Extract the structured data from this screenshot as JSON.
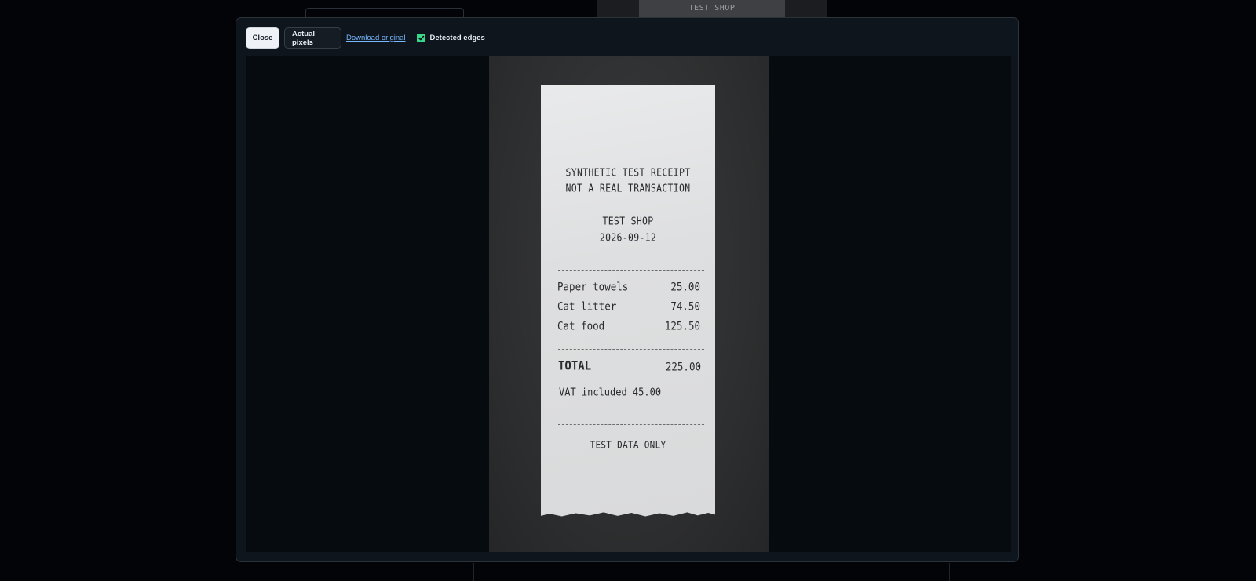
{
  "background": {
    "thumb_text": "TEST SHOP"
  },
  "toolbar": {
    "close_label": "Close",
    "actual_pixels_label": "Actual pixels",
    "download_label": "Download original",
    "detected_edges_label": "Detected edges",
    "detected_edges_checked": true
  },
  "receipt": {
    "header_line1": "SYNTHETIC TEST RECEIPT",
    "header_line2": "NOT A REAL TRANSACTION",
    "shop": "TEST SHOP",
    "date": "2026-09-12",
    "items": [
      {
        "name": "Paper towels",
        "price": "25.00"
      },
      {
        "name": "Cat litter",
        "price": "74.50"
      },
      {
        "name": "Cat food",
        "price": "125.50"
      }
    ],
    "total_label": "TOTAL",
    "total_value": "225.00",
    "vat_line": "VAT included 45.00",
    "footer": "TEST DATA ONLY"
  },
  "colors": {
    "accent_link": "#79b8ff",
    "checkbox": "#39d98a",
    "modal_bg": "#0e151d"
  }
}
